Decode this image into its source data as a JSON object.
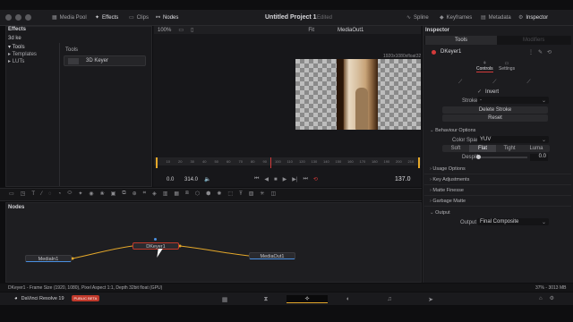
{
  "topbar": {
    "media_pool": "Media Pool",
    "effects": "Effects",
    "clips": "Clips",
    "nodes": "Nodes",
    "project_title": "Untitled Project 1",
    "edited": "Edited",
    "spline": "Spline",
    "keyframes": "Keyframes",
    "metadata": "Metadata",
    "inspector": "Inspector"
  },
  "effects_panel": {
    "title": "Effects",
    "search": "3d ke",
    "tree": [
      "Tools",
      "Templates",
      "LUTs"
    ],
    "col_header": "Tools",
    "result": "3D Keyer"
  },
  "viewer": {
    "zoom": "100%",
    "fit": "Fit",
    "clip_name": "MediaOut1",
    "format": "1920x1080xfloat32",
    "ruler": [
      "0",
      "10",
      "20",
      "30",
      "40",
      "50",
      "60",
      "70",
      "80",
      "90",
      "100",
      "110",
      "120",
      "130",
      "140",
      "150",
      "160",
      "170",
      "180",
      "190",
      "200",
      "210"
    ],
    "in_value": "0.0",
    "out_value": "314.0",
    "frame": "137.0"
  },
  "nodes_panel": {
    "title": "Nodes",
    "media_in": "MediaIn1",
    "keyer": "DKeyer1",
    "media_out": "MediaOut1"
  },
  "status": {
    "left": "DKeyer1 - Frame Size (1920, 1080), Pixel Aspect 1:1, Depth 32bit float (GPU)",
    "right": "37% - 3013 MB"
  },
  "bottombar": {
    "app": "DaVinci Resolve 19",
    "badge": "PUBLIC BETA"
  },
  "inspector": {
    "title": "Inspector",
    "tab_tools": "Tools",
    "tab_modifiers": "Modifiers",
    "node_name": "DKeyer1",
    "controls": "Controls",
    "settings": "Settings",
    "invert": "Invert",
    "stroke_label": "Stroke",
    "stroke_value": "-",
    "delete_stroke": "Delete Stroke",
    "reset": "Reset",
    "behaviour_options": "Behaviour Options",
    "color_space_label": "Color Space",
    "color_space_value": "YUV",
    "soft": "Soft",
    "flat": "Flat",
    "tight": "Tight",
    "luma": "Luma",
    "despill_label": "Despill",
    "despill_value": "0.0",
    "sections": [
      "Usage Options",
      "Key Adjustments",
      "Matte Finesse",
      "Garbage Matte"
    ],
    "output": "Output",
    "output_label": "Output",
    "output_value": "Final Composite"
  },
  "colors": {
    "accent": "#d43a3a",
    "playhead": "#d43a3a",
    "wire": "#e5a82a",
    "node_border": "#c0392b"
  }
}
